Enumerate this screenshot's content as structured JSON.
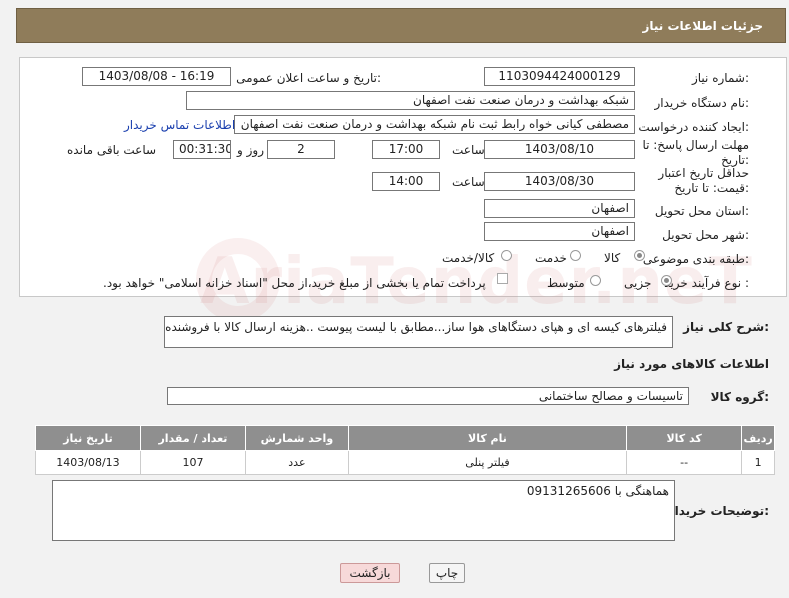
{
  "header": {
    "title": "جزئیات اطلاعات نیاز"
  },
  "fields": {
    "need_number_label": "شماره نیاز:",
    "need_number": "1103094424000129",
    "announce_label": "تاریخ و ساعت اعلان عمومی:",
    "announce_value": "1403/08/08 - 16:19",
    "buyer_org_label": "نام دستگاه خریدار:",
    "buyer_org": "شبکه بهداشت و درمان صنعت نفت اصفهان",
    "creator_label": "ایجاد کننده درخواست:",
    "creator": "مصطفی کیانی خواه رابط ثبت نام شبکه بهداشت و درمان صنعت نفت اصفهان",
    "contact_link": "اطلاعات تماس خریدار",
    "reply_deadline_label": "مهلت ارسال پاسخ: تا تاریخ:",
    "reply_date": "1403/08/10",
    "time_label": "ساعت",
    "reply_time": "17:00",
    "days_value": "2",
    "days_label": "روز و",
    "remaining_value": "00:31:30",
    "remaining_label": "ساعت باقی مانده",
    "price_deadline_label": "حداقل تاریخ اعتبار قیمت: تا تاریخ:",
    "price_date": "1403/08/30",
    "price_time": "14:00",
    "province_label": "استان محل تحویل:",
    "province": "اصفهان",
    "city_label": "شهر محل تحویل:",
    "city": "اصفهان",
    "category_label": "طبقه بندی موضوعی:",
    "category_options": [
      "کالا",
      "خدمت",
      "کالا/خدمت"
    ],
    "process_label": "نوع فرآیند خرید :",
    "process_options": [
      "جزیی",
      "متوسط"
    ],
    "payment_note": "پرداخت تمام یا بخشی از مبلغ خرید،از محل \"اسناد خزانه اسلامی\" خواهد بود."
  },
  "description": {
    "label": "شرح کلی نیاز:",
    "text": "فیلترهای کیسه ای و هپای  دستگاهای هوا ساز...مطابق با لیست پیوست ..هزینه ارسال کالا با فروشنده .."
  },
  "goods_section": {
    "title": "اطلاعات کالاهای مورد نیاز",
    "group_label": "گروه کالا:",
    "group_value": "تاسیسات و مصالح ساختمانی"
  },
  "table": {
    "headers": [
      "ردیف",
      "کد کالا",
      "نام کالا",
      "واحد شمارش",
      "تعداد / مقدار",
      "تاریخ نیاز"
    ],
    "rows": [
      [
        "1",
        "--",
        "فیلتر پنلی",
        "عدد",
        "107",
        "1403/08/13"
      ]
    ]
  },
  "buyer_notes": {
    "label": "توضیحات خریدار:",
    "text": "هماهنگی با 09131265606"
  },
  "buttons": {
    "print": "چاپ",
    "back": "بازگشت"
  },
  "watermark": {
    "text": "AriaTender.neT"
  },
  "colors": {
    "header_bg": "#8f7c5a",
    "table_header_bg": "#8f8f8f",
    "link": "#1a3fae",
    "back_button_bg": "#f7d9d9"
  }
}
